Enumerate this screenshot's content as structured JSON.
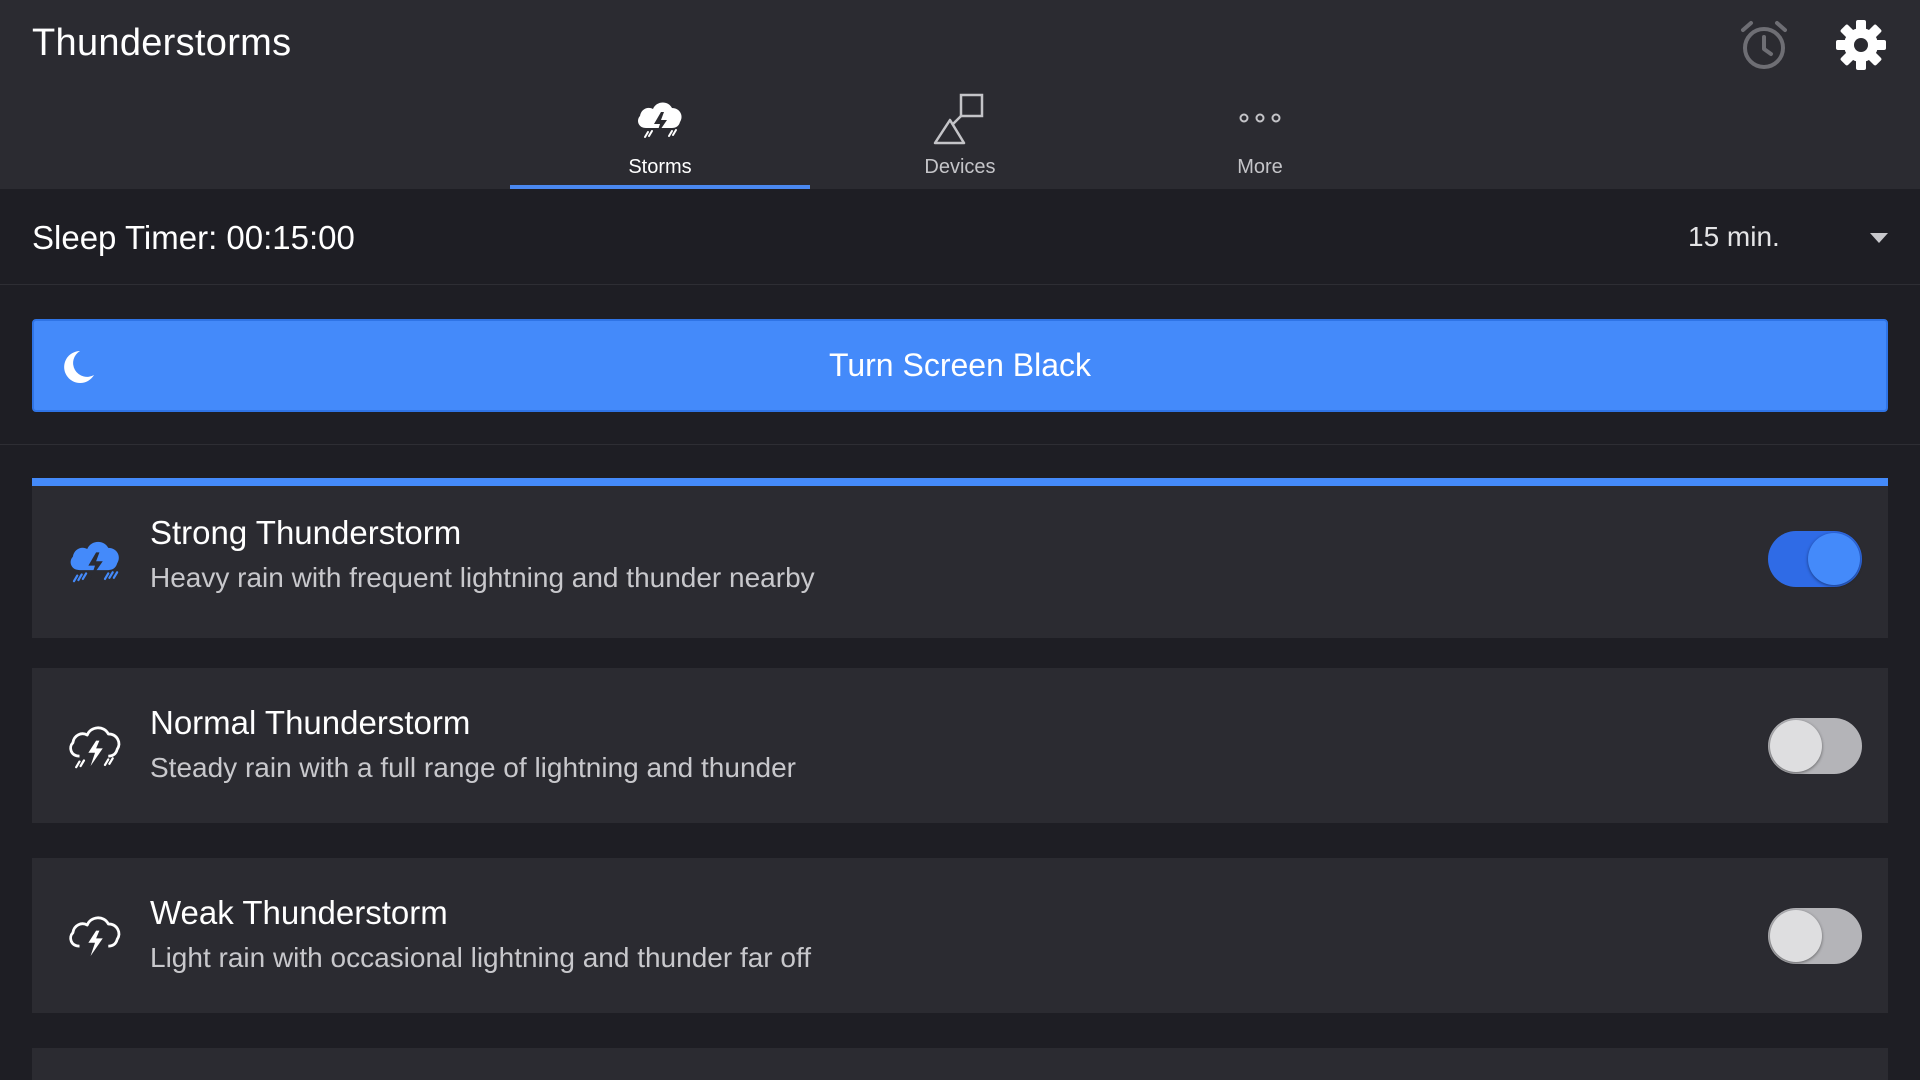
{
  "app": {
    "title": "Thunderstorms"
  },
  "header": {
    "alarm_icon": "alarm-clock-icon",
    "settings_icon": "gear-icon"
  },
  "tabs": [
    {
      "label": "Storms",
      "icon": "storm-cloud-icon",
      "active": true
    },
    {
      "label": "Devices",
      "icon": "devices-shapes-icon",
      "active": false
    },
    {
      "label": "More",
      "icon": "more-dots-icon",
      "active": false
    }
  ],
  "sleep_timer": {
    "label": "Sleep Timer: 00:15:00",
    "selected_option": "15 min."
  },
  "black_screen_button": {
    "label": "Turn Screen Black",
    "icon": "moon-icon"
  },
  "storms": [
    {
      "title": "Strong Thunderstorm",
      "description": "Heavy rain with frequent lightning and thunder nearby",
      "enabled": true
    },
    {
      "title": "Normal Thunderstorm",
      "description": "Steady rain with a full range of lightning and thunder",
      "enabled": false
    },
    {
      "title": "Weak Thunderstorm",
      "description": "Light rain with occasional lightning and thunder far off",
      "enabled": false
    }
  ],
  "colors": {
    "accent": "#448afa",
    "background": "#1e1e24",
    "surface": "#2b2b31"
  }
}
